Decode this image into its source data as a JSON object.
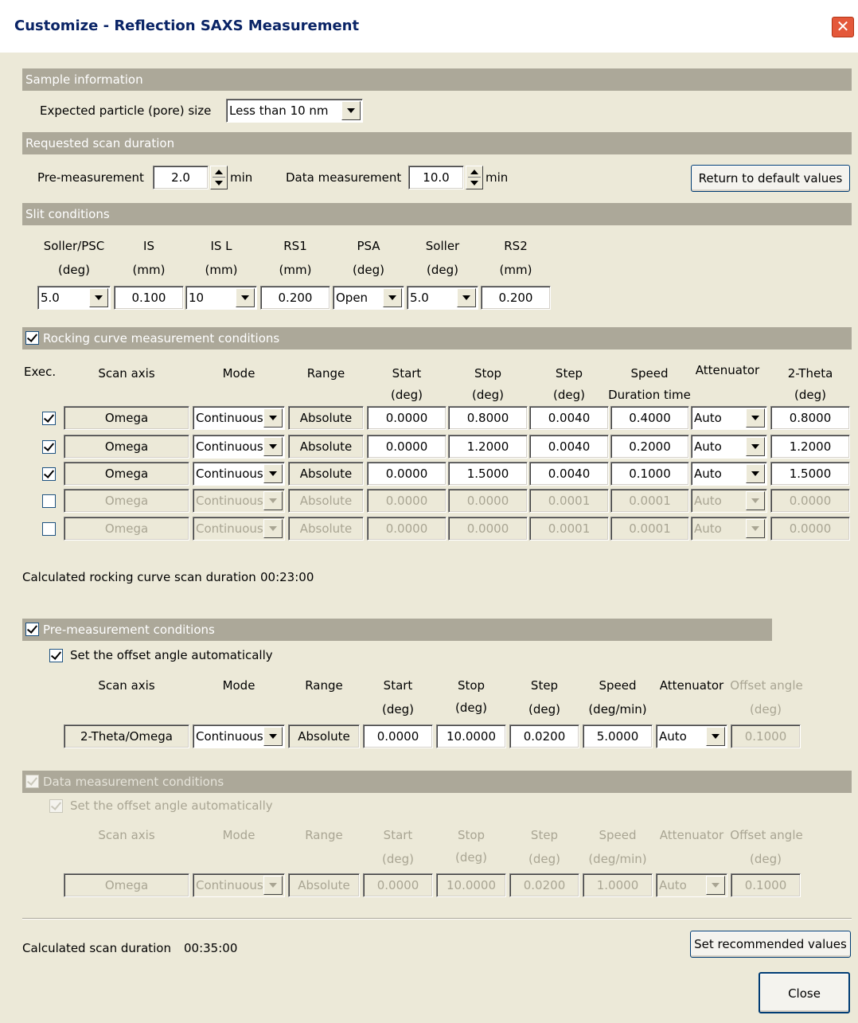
{
  "window": {
    "title": "Customize - Reflection SAXS Measurement",
    "close_glyph": "✕"
  },
  "sample": {
    "header": "Sample information",
    "particle_label": "Expected particle (pore) size",
    "particle_value": "Less than 10 nm"
  },
  "duration": {
    "header": "Requested scan duration",
    "pre_label": "Pre-measurement",
    "pre_value": "2.0",
    "pre_unit": "min",
    "data_label": "Data measurement",
    "data_value": "10.0",
    "data_unit": "min",
    "default_button": "Return to default values"
  },
  "slit": {
    "header": "Slit conditions",
    "columns": [
      {
        "name": "Soller/PSC",
        "unit": "(deg)",
        "value": "5.0",
        "kind": "select"
      },
      {
        "name": "IS",
        "unit": "(mm)",
        "value": "0.100",
        "kind": "text"
      },
      {
        "name": "IS L",
        "unit": "(mm)",
        "value": "10",
        "kind": "select"
      },
      {
        "name": "RS1",
        "unit": "(mm)",
        "value": "0.200",
        "kind": "text"
      },
      {
        "name": "PSA",
        "unit": "(deg)",
        "value": "Open",
        "kind": "select"
      },
      {
        "name": "Soller",
        "unit": "(deg)",
        "value": "5.0",
        "kind": "select"
      },
      {
        "name": "RS2",
        "unit": "(mm)",
        "value": "0.200",
        "kind": "text"
      }
    ]
  },
  "rocking": {
    "header": "Rocking curve measurement conditions",
    "headers": {
      "exec": "Exec.",
      "scan_axis": "Scan axis",
      "mode": "Mode",
      "range": "Range",
      "start": "Start",
      "start_unit": "(deg)",
      "stop": "Stop",
      "stop_unit": "(deg)",
      "step": "Step",
      "step_unit": "(deg)",
      "speed": "Speed",
      "speed_unit": "Duration time",
      "attenuator": "Attenuator",
      "two_theta": "2-Theta",
      "two_theta_unit": "(deg)"
    },
    "rows": [
      {
        "checked": true,
        "axis": "Omega",
        "mode": "Continuous",
        "range": "Absolute",
        "start": "0.0000",
        "stop": "0.8000",
        "step": "0.0040",
        "speed": "0.4000",
        "att": "Auto",
        "two_theta": "0.8000"
      },
      {
        "checked": true,
        "axis": "Omega",
        "mode": "Continuous",
        "range": "Absolute",
        "start": "0.0000",
        "stop": "1.2000",
        "step": "0.0040",
        "speed": "0.2000",
        "att": "Auto",
        "two_theta": "1.2000"
      },
      {
        "checked": true,
        "axis": "Omega",
        "mode": "Continuous",
        "range": "Absolute",
        "start": "0.0000",
        "stop": "1.5000",
        "step": "0.0040",
        "speed": "0.1000",
        "att": "Auto",
        "two_theta": "1.5000"
      },
      {
        "checked": false,
        "axis": "Omega",
        "mode": "Continuous",
        "range": "Absolute",
        "start": "0.0000",
        "stop": "0.0000",
        "step": "0.0001",
        "speed": "0.0001",
        "att": "Auto",
        "two_theta": "0.0000"
      },
      {
        "checked": false,
        "axis": "Omega",
        "mode": "Continuous",
        "range": "Absolute",
        "start": "0.0000",
        "stop": "0.0000",
        "step": "0.0001",
        "speed": "0.0001",
        "att": "Auto",
        "two_theta": "0.0000"
      }
    ],
    "calc_label": "Calculated rocking curve scan duration",
    "calc_value": "00:23:00"
  },
  "pre": {
    "header": "Pre-measurement conditions",
    "offset_label": "Set the offset angle automatically",
    "headers": {
      "scan_axis": "Scan axis",
      "mode": "Mode",
      "range": "Range",
      "start": "Start",
      "start_unit": "(deg)",
      "stop": "Stop",
      "stop_unit": "(deg)",
      "step": "Step",
      "step_unit": "(deg)",
      "speed": "Speed",
      "speed_unit": "(deg/min)",
      "attenuator": "Attenuator",
      "offset": "Offset angle",
      "offset_unit": "(deg)"
    },
    "row": {
      "axis": "2-Theta/Omega",
      "mode": "Continuous",
      "range": "Absolute",
      "start": "0.0000",
      "stop": "10.0000",
      "step": "0.0200",
      "speed": "5.0000",
      "att": "Auto",
      "offset": "0.1000"
    }
  },
  "data": {
    "header": "Data measurement conditions",
    "offset_label": "Set the offset angle automatically",
    "headers": {
      "scan_axis": "Scan axis",
      "mode": "Mode",
      "range": "Range",
      "start": "Start",
      "start_unit": "(deg)",
      "stop": "Stop",
      "stop_unit": "(deg)",
      "step": "Step",
      "step_unit": "(deg)",
      "speed": "Speed",
      "speed_unit": "(deg/min)",
      "attenuator": "Attenuator",
      "offset": "Offset angle",
      "offset_unit": "(deg)"
    },
    "row": {
      "axis": "Omega",
      "mode": "Continuous",
      "range": "Absolute",
      "start": "0.0000",
      "stop": "10.0000",
      "step": "0.0200",
      "speed": "1.0000",
      "att": "Auto",
      "offset": "0.1000"
    }
  },
  "footer": {
    "calc_label": "Calculated scan duration",
    "calc_value": "00:35:00",
    "recommended_button": "Set recommended values",
    "close_button": "Close"
  }
}
